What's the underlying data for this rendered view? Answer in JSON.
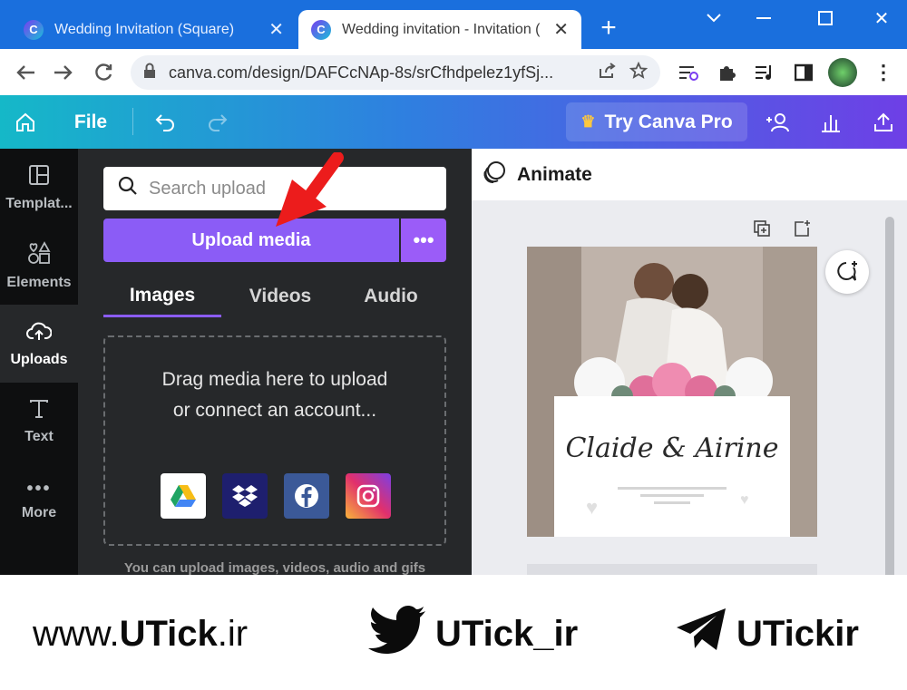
{
  "browser": {
    "tabs": [
      {
        "title": "Wedding Invitation (Square)",
        "active": false
      },
      {
        "title": "Wedding invitation - Invitation (",
        "active": true
      }
    ],
    "url": "canva.com/design/DAFCcNAp-8s/srCfhdpelez1yfSj..."
  },
  "canva": {
    "file_label": "File",
    "try_pro_label": "Try Canva Pro",
    "rail": [
      {
        "label": "Templat...",
        "icon": "templates-icon"
      },
      {
        "label": "Elements",
        "icon": "elements-icon"
      },
      {
        "label": "Uploads",
        "icon": "uploads-icon",
        "active": true
      },
      {
        "label": "Text",
        "icon": "text-icon"
      },
      {
        "label": "More",
        "icon": "more-icon"
      }
    ],
    "search_placeholder": "Search upload",
    "upload_button": "Upload media",
    "more_button": "•••",
    "media_tabs": [
      {
        "label": "Images",
        "active": true
      },
      {
        "label": "Videos"
      },
      {
        "label": "Audio"
      }
    ],
    "drop_text": "Drag media here to upload or connect an account...",
    "services": [
      "Google Drive",
      "Dropbox",
      "Facebook",
      "Instagram"
    ],
    "hint": "You can upload images, videos, audio and gifs",
    "animate_label": "Animate",
    "design": {
      "names": "Claide & Airine"
    }
  },
  "watermark": {
    "website_prefix": "www.",
    "website_brand": "UTick",
    "website_suffix": ".ir",
    "twitter": "UTick_ir",
    "telegram": "UTickir"
  },
  "colors": {
    "tab_bar": "#1a6fdd",
    "purple": "#8b5cf6",
    "panel": "#26282a"
  }
}
